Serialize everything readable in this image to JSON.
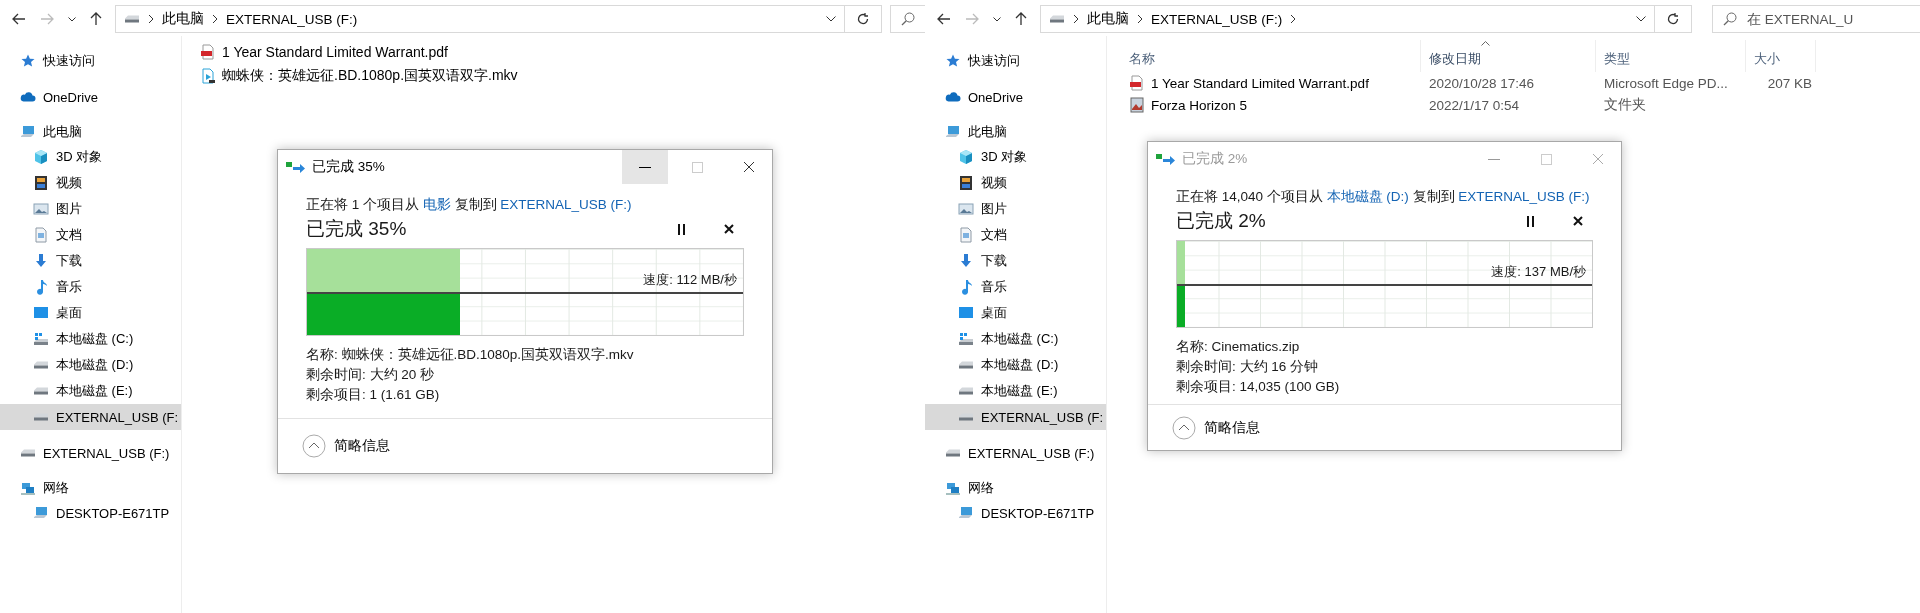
{
  "windows": [
    {
      "address": {
        "crumbs": [
          "此电脑",
          "EXTERNAL_USB (F:)"
        ],
        "end_chevron": false
      },
      "sidebar": {
        "items": [
          {
            "label": "快速访问",
            "kind": "star",
            "selected": false
          },
          {
            "label": "OneDrive",
            "kind": "cloud",
            "selected": false
          },
          {
            "label": "此电脑",
            "kind": "pc",
            "selected": false,
            "children": [
              {
                "label": "3D 对象",
                "kind": "cube",
                "selected": false
              },
              {
                "label": "视频",
                "kind": "video",
                "selected": false
              },
              {
                "label": "图片",
                "kind": "picture",
                "selected": false
              },
              {
                "label": "文档",
                "kind": "document",
                "selected": false
              },
              {
                "label": "下载",
                "kind": "download",
                "selected": false
              },
              {
                "label": "音乐",
                "kind": "music",
                "selected": false
              },
              {
                "label": "桌面",
                "kind": "desktop",
                "selected": false
              },
              {
                "label": "本地磁盘 (C:)",
                "kind": "sysdrive",
                "selected": false
              },
              {
                "label": "本地磁盘 (D:)",
                "kind": "drive",
                "selected": false
              },
              {
                "label": "本地磁盘 (E:)",
                "kind": "drive",
                "selected": false
              },
              {
                "label": "EXTERNAL_USB (F:",
                "kind": "drive",
                "selected": true
              }
            ]
          },
          {
            "label": "EXTERNAL_USB (F:)",
            "kind": "drive",
            "selected": false
          },
          {
            "label": "网络",
            "kind": "network",
            "selected": false,
            "children": [
              {
                "label": "DESKTOP-E671TP",
                "kind": "pc",
                "selected": false
              }
            ]
          }
        ]
      },
      "files": {
        "rows": [
          {
            "kind": "pdf",
            "cells": [
              "1 Year Standard Limited Warrant.pdf"
            ]
          },
          {
            "kind": "videofile",
            "cells": [
              "蜘蛛侠：英雄远征.BD.1080p.国英双语双字.mkv"
            ]
          }
        ]
      },
      "dialog": {
        "title": "已完成 35%",
        "active": true,
        "minimize_hovered": true,
        "description": [
          {
            "text": "正在将 1 个项目从 ",
            "link": false
          },
          {
            "text": "电影",
            "link": true
          },
          {
            "text": " 复制到 ",
            "link": false
          },
          {
            "text": "EXTERNAL_USB (F:)",
            "link": true
          }
        ],
        "heading": "已完成 35%",
        "level": 0.35,
        "speed": "速度: 112 MB/秒",
        "details": [
          "名称: 蜘蛛侠：英雄远征.BD.1080p.国英双语双字.mkv",
          "剩余时间: 大约 20 秒",
          "剩余项目: 1 (1.61 GB)"
        ],
        "footer": "简略信息"
      }
    },
    {
      "address": {
        "crumbs": [
          "此电脑",
          "EXTERNAL_USB (F:)"
        ],
        "end_chevron": true
      },
      "search": {
        "placeholder": "在 EXTERNAL_U"
      },
      "sidebar": {
        "items": [
          {
            "label": "快速访问",
            "kind": "star",
            "selected": false
          },
          {
            "label": "OneDrive",
            "kind": "cloud",
            "selected": false
          },
          {
            "label": "此电脑",
            "kind": "pc",
            "selected": false,
            "children": [
              {
                "label": "3D 对象",
                "kind": "cube",
                "selected": false
              },
              {
                "label": "视频",
                "kind": "video",
                "selected": false
              },
              {
                "label": "图片",
                "kind": "picture",
                "selected": false
              },
              {
                "label": "文档",
                "kind": "document",
                "selected": false
              },
              {
                "label": "下载",
                "kind": "download",
                "selected": false
              },
              {
                "label": "音乐",
                "kind": "music",
                "selected": false
              },
              {
                "label": "桌面",
                "kind": "desktop",
                "selected": false
              },
              {
                "label": "本地磁盘 (C:)",
                "kind": "sysdrive",
                "selected": false
              },
              {
                "label": "本地磁盘 (D:)",
                "kind": "drive",
                "selected": false
              },
              {
                "label": "本地磁盘 (E:)",
                "kind": "drive",
                "selected": false
              },
              {
                "label": "EXTERNAL_USB (F:",
                "kind": "drive",
                "selected": true
              }
            ]
          },
          {
            "label": "EXTERNAL_USB (F:)",
            "kind": "drive",
            "selected": false
          },
          {
            "label": "网络",
            "kind": "network",
            "selected": false,
            "children": [
              {
                "label": "DESKTOP-E671TP",
                "kind": "pc",
                "selected": false
              }
            ]
          }
        ]
      },
      "files": {
        "columns": [
          {
            "label": "名称",
            "sorted": false
          },
          {
            "label": "修改日期",
            "sorted": true
          },
          {
            "label": "类型",
            "sorted": false
          },
          {
            "label": "大小",
            "sorted": false
          }
        ],
        "rows": [
          {
            "kind": "pdf",
            "cells": [
              "1 Year Standard Limited Warrant.pdf",
              "2020/10/28 17:46",
              "Microsoft Edge PD...",
              "207 KB"
            ]
          },
          {
            "kind": "game",
            "cells": [
              "Forza Horizon 5",
              "2022/1/17 0:54",
              "文件夹"
            ]
          }
        ]
      },
      "dialog": {
        "title": "已完成 2%",
        "active": false,
        "minimize_hovered": false,
        "description": [
          {
            "text": "正在将 14,040 个项目从 ",
            "link": false
          },
          {
            "text": "本地磁盘 (D:)",
            "link": true
          },
          {
            "text": " 复制到 ",
            "link": false
          },
          {
            "text": "EXTERNAL_USB (F:)",
            "link": true
          }
        ],
        "heading": "已完成 2%",
        "level": 0.02,
        "speed": "速度: 137 MB/秒",
        "details": [
          "名称: Cinematics.zip",
          "剩余时间: 大约 16 分钟",
          "剩余项目: 14,035 (100 GB)"
        ],
        "footer": "简略信息"
      }
    }
  ]
}
